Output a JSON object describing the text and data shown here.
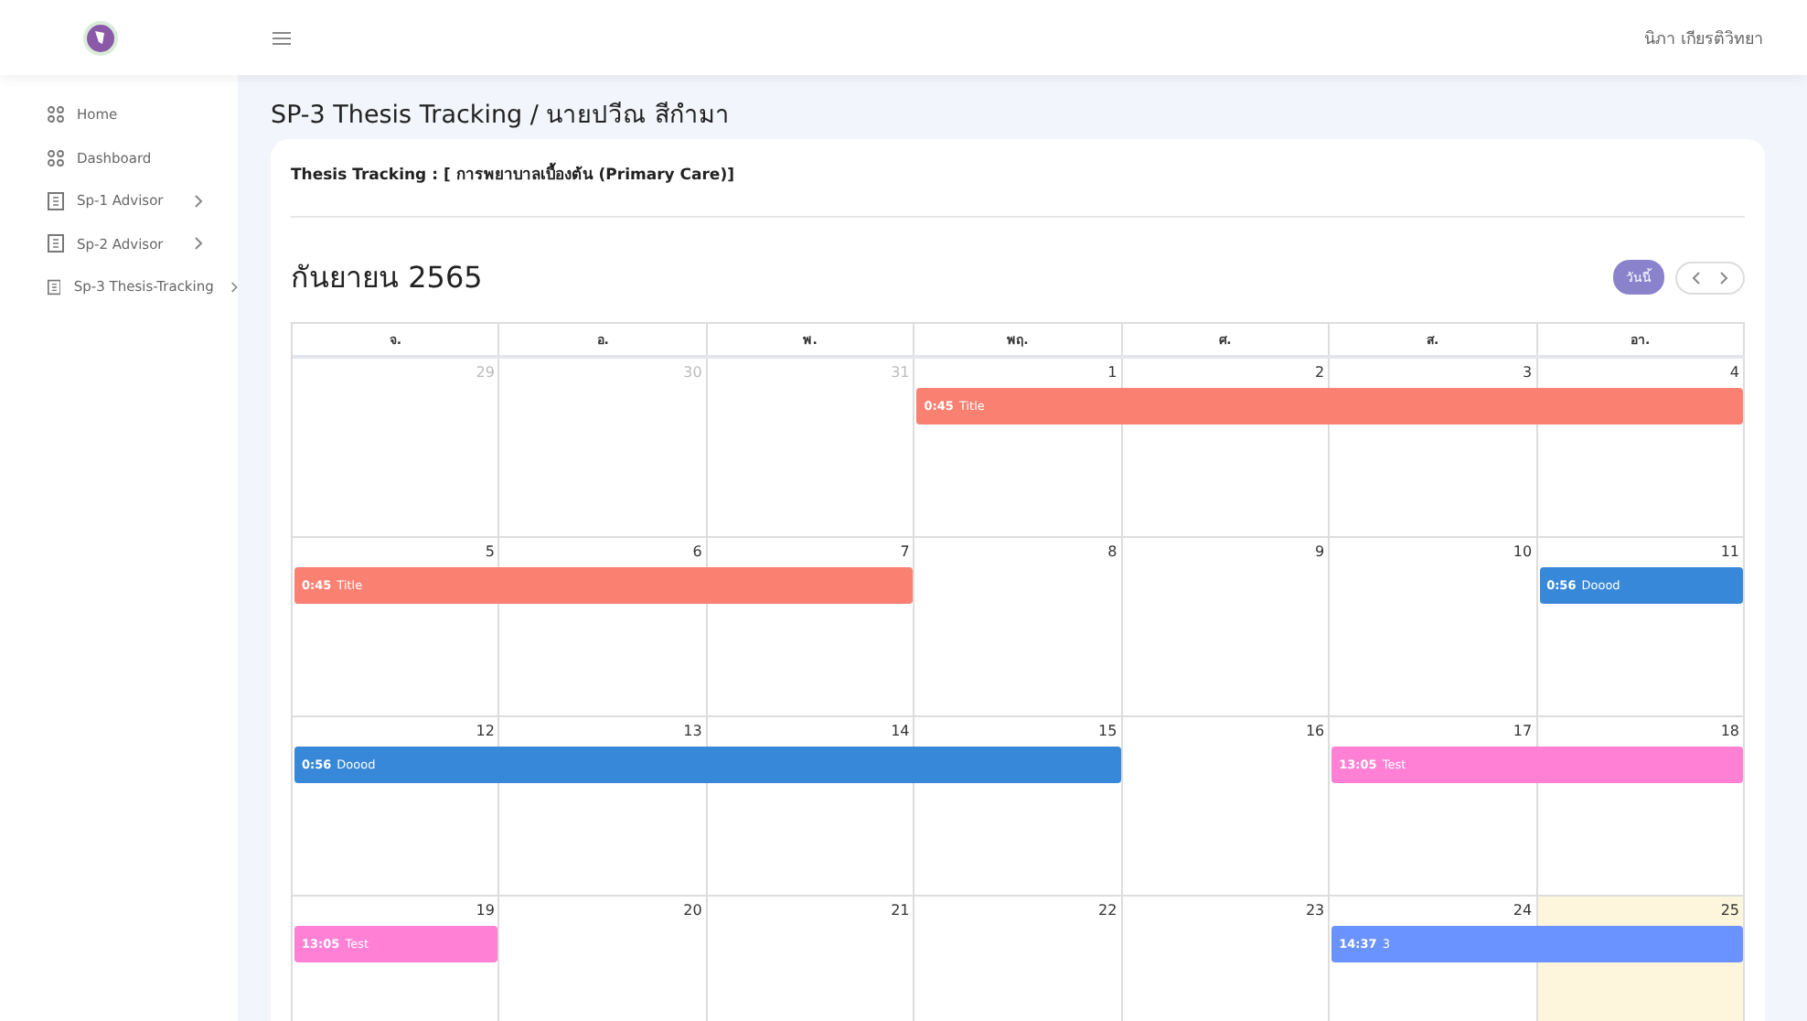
{
  "header": {
    "user_name": "นิภา เกียรติวิทยา"
  },
  "sidebar": {
    "items": [
      {
        "label": "Home",
        "kind": "grid",
        "has_submenu": false
      },
      {
        "label": "Dashboard",
        "kind": "grid",
        "has_submenu": false
      },
      {
        "label": "Sp-1 Advisor",
        "kind": "doc",
        "has_submenu": true
      },
      {
        "label": "Sp-2 Advisor",
        "kind": "doc",
        "has_submenu": true
      },
      {
        "label": "Sp-3 Thesis-Tracking",
        "kind": "doc",
        "has_submenu": true
      }
    ]
  },
  "page_title": "SP-3 Thesis Tracking / นายปวีณ สีกำมา",
  "card": {
    "subtitle": "Thesis Tracking : [ การพยาบาลเบื้องต้น (Primary Care)]"
  },
  "calendar": {
    "month_title": "กันยายน 2565",
    "today_button": "วันนี้",
    "weekdays": [
      "จ.",
      "อ.",
      "พ.",
      "พฤ.",
      "ศ.",
      "ส.",
      "อา."
    ],
    "weeks": [
      {
        "days": [
          {
            "number": "29",
            "outside": true,
            "today": false,
            "continued": false
          },
          {
            "number": "30",
            "outside": true,
            "today": false,
            "continued": false
          },
          {
            "number": "31",
            "outside": true,
            "today": false,
            "continued": false
          },
          {
            "number": "1",
            "outside": false,
            "today": false,
            "continued": false,
            "event": {
              "time": "0:45",
              "title": "Title",
              "color": "#fa8072"
            }
          },
          {
            "number": "2",
            "outside": false,
            "today": false,
            "continued": true
          },
          {
            "number": "3",
            "outside": false,
            "today": false,
            "continued": true
          },
          {
            "number": "4",
            "outside": false,
            "today": false,
            "continued": true
          }
        ]
      },
      {
        "days": [
          {
            "number": "5",
            "outside": false,
            "today": false,
            "continued": false,
            "event": {
              "time": "0:45",
              "title": "Title",
              "color": "#fa8072"
            }
          },
          {
            "number": "6",
            "outside": false,
            "today": false,
            "continued": true
          },
          {
            "number": "7",
            "outside": false,
            "today": false,
            "continued": true
          },
          {
            "number": "8",
            "outside": false,
            "today": false,
            "continued": false
          },
          {
            "number": "9",
            "outside": false,
            "today": false,
            "continued": false
          },
          {
            "number": "10",
            "outside": false,
            "today": false,
            "continued": false
          },
          {
            "number": "11",
            "outside": false,
            "today": false,
            "continued": false,
            "event": {
              "time": "0:56",
              "title": "Doood",
              "color": "#3788d8"
            }
          }
        ]
      },
      {
        "days": [
          {
            "number": "12",
            "outside": false,
            "today": false,
            "continued": false,
            "event": {
              "time": "0:56",
              "title": "Doood",
              "color": "#3788d8"
            }
          },
          {
            "number": "13",
            "outside": false,
            "today": false,
            "continued": true
          },
          {
            "number": "14",
            "outside": false,
            "today": false,
            "continued": true
          },
          {
            "number": "15",
            "outside": false,
            "today": false,
            "continued": true
          },
          {
            "number": "16",
            "outside": false,
            "today": false,
            "continued": false
          },
          {
            "number": "17",
            "outside": false,
            "today": false,
            "continued": false,
            "event": {
              "time": "13:05",
              "title": "Test",
              "color": "#ff80d5"
            }
          },
          {
            "number": "18",
            "outside": false,
            "today": false,
            "continued": true
          }
        ]
      },
      {
        "days": [
          {
            "number": "19",
            "outside": false,
            "today": false,
            "continued": false,
            "event": {
              "time": "13:05",
              "title": "Test",
              "color": "#ff80d5"
            }
          },
          {
            "number": "20",
            "outside": false,
            "today": false,
            "continued": false
          },
          {
            "number": "21",
            "outside": false,
            "today": false,
            "continued": false
          },
          {
            "number": "22",
            "outside": false,
            "today": false,
            "continued": false
          },
          {
            "number": "23",
            "outside": false,
            "today": false,
            "continued": false
          },
          {
            "number": "24",
            "outside": false,
            "today": false,
            "continued": false,
            "event": {
              "time": "14:37",
              "title": "3",
              "color": "#6b93ff"
            }
          },
          {
            "number": "25",
            "outside": false,
            "today": true,
            "continued": true
          }
        ]
      }
    ]
  }
}
